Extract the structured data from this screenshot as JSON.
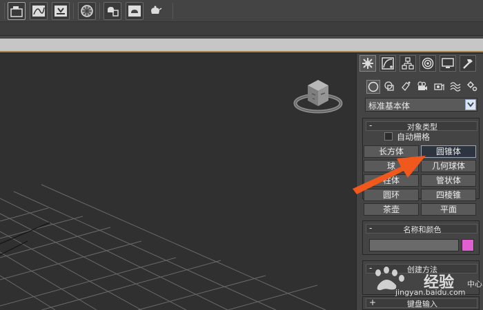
{
  "toolbar": {
    "buttons": [
      "layer-manager-icon",
      "curve-editor-icon",
      "schematic-view-icon",
      "material-editor-icon",
      "render-setup-icon",
      "rendered-frame-window-icon",
      "render-production-icon"
    ]
  },
  "viewport": {
    "background": "#303030",
    "grid_color": "#6a6a6a",
    "viewcube": "viewcube-icon"
  },
  "command_panel": {
    "tabs": [
      "create-tab-icon",
      "modify-tab-icon",
      "hierarchy-tab-icon",
      "motion-tab-icon",
      "display-tab-icon",
      "utilities-tab-icon"
    ],
    "subcategories": [
      "geometry-icon",
      "shapes-icon",
      "lights-icon",
      "cameras-icon",
      "helpers-icon",
      "space-warps-icon",
      "systems-icon"
    ],
    "category": "标准基本体",
    "object_type": {
      "title": "对象类型",
      "collapse_sign": "-",
      "autogrid_label": "自动栅格",
      "buttons": [
        {
          "label": "长方体"
        },
        {
          "label": "圆锥体"
        },
        {
          "label": "球"
        },
        {
          "label": "几何球体"
        },
        {
          "label": "柱体"
        },
        {
          "label": "管状体"
        },
        {
          "label": "圆环"
        },
        {
          "label": "四棱锥"
        },
        {
          "label": "茶壶"
        },
        {
          "label": "平面"
        }
      ]
    },
    "name_and_color": {
      "title": "名称和颜色",
      "collapse_sign": "-",
      "color": "#e160cf"
    },
    "creation_method": {
      "title": "创建方法",
      "collapse_sign": "-",
      "edge_label": "中心"
    },
    "keyboard_entry": {
      "title": "键盘输入",
      "collapse_sign": "+"
    }
  },
  "overlay": {
    "arrow_color": "#f0581c",
    "watermark_text": "经验",
    "watermark_url": "jingyan.baidu.com"
  }
}
